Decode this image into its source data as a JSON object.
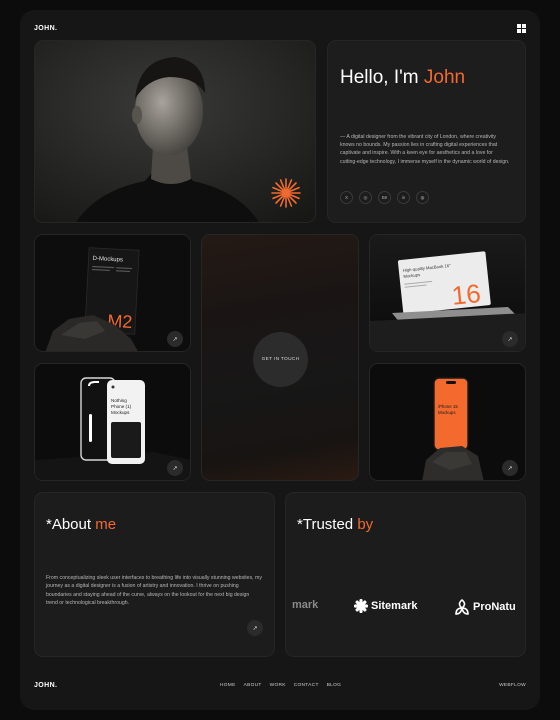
{
  "header": {
    "logo": "JOHN.",
    "menu_icon": "grid-menu-icon"
  },
  "hero": {
    "image_alt": "portrait",
    "icon": "sunburst-icon",
    "accent": "#f26a2e"
  },
  "intro": {
    "greeting": "Hello, I'm ",
    "name": "John",
    "bio": "— A digital designer from the vibrant city of London, where creativity knows no bounds. My passion lies in crafting digital experiences that captivate and inspire. With a keen eye for aesthetics and a love for cutting-edge technology, I immerse myself in the dynamic world of design.",
    "socials": [
      {
        "label": "X",
        "icon": "x-icon"
      },
      {
        "label": "◎",
        "icon": "instagram-icon"
      },
      {
        "label": "Bē",
        "icon": "behance-icon"
      },
      {
        "label": "in",
        "icon": "linkedin-icon"
      },
      {
        "label": "◍",
        "icon": "dribbble-icon"
      }
    ]
  },
  "work": {
    "w1": {
      "title": "D-Mockups",
      "number": "M2"
    },
    "w2": {
      "title": "Nothing Phone (1) Mockups"
    },
    "w3": {
      "title": "High-quality MacBook 16\" Mockups",
      "number": "16"
    },
    "w4": {
      "title": "iPhone 15 Mockups"
    },
    "arrow": "↗"
  },
  "cta": {
    "label": "GET IN TOUCH"
  },
  "about": {
    "prefix": "*About ",
    "accent": "me",
    "text": "From conceptualizing sleek user interfaces to breathing life into visually stunning websites, my journey as a digital designer is a fusion of artistry and innovation. I thrive on pushing boundaries and staying ahead of the curve, always on the lookout for the next big design trend or technological breakthrough."
  },
  "trusted": {
    "prefix": "*Trusted ",
    "accent": "by",
    "logos": [
      "mark",
      "Sitemark",
      "ProNatu"
    ]
  },
  "footer": {
    "logo": "JOHN.",
    "nav": [
      "HOME",
      "ABOUT",
      "WORK",
      "CONTACT",
      "BLOG"
    ],
    "credit": "WEBFLOW"
  }
}
